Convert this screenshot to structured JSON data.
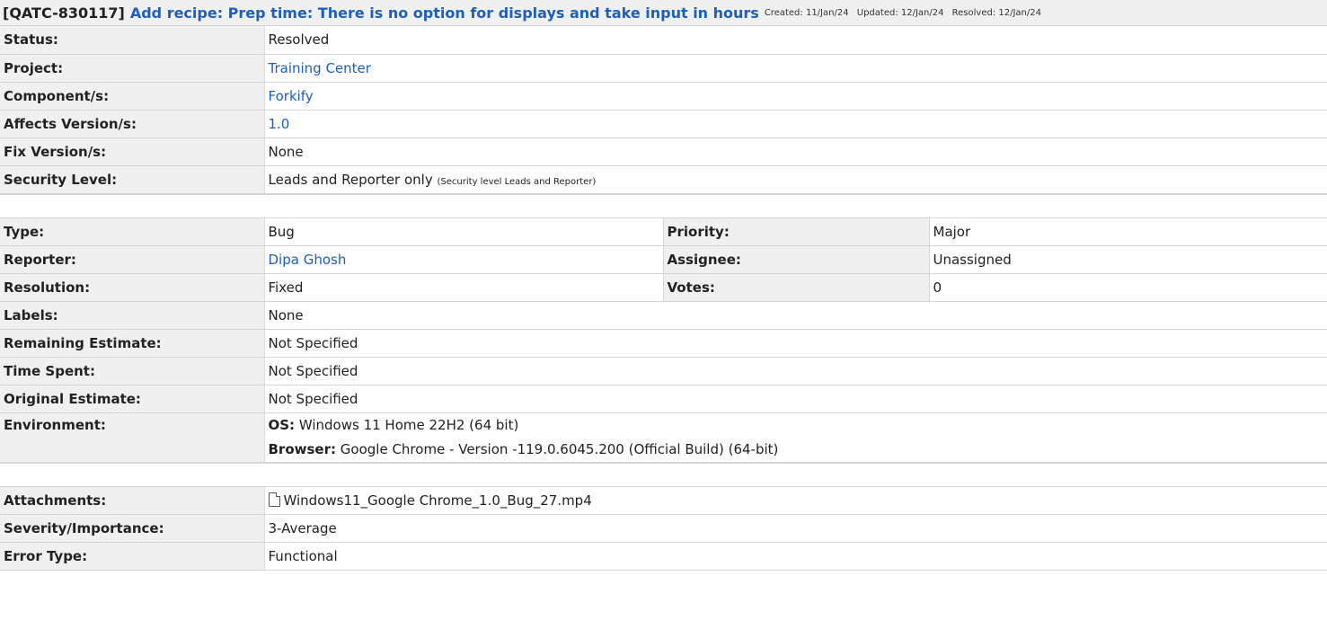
{
  "header": {
    "issue_key": "[QATC-830117]",
    "summary": "Add recipe: Prep time: There is no option for displays and take input in hours",
    "created": "Created: 11/Jan/24",
    "updated": "Updated: 12/Jan/24",
    "resolved": "Resolved: 12/Jan/24"
  },
  "details": {
    "status": {
      "label": "Status:",
      "value": "Resolved"
    },
    "project": {
      "label": "Project:",
      "value": "Training Center"
    },
    "component": {
      "label": "Component/s:",
      "value": "Forkify"
    },
    "affects_version": {
      "label": "Affects Version/s:",
      "value": "1.0"
    },
    "fix_version": {
      "label": "Fix Version/s:",
      "value": "None"
    },
    "security_level": {
      "label": "Security Level:",
      "value": "Leads and Reporter only",
      "note": "(Security level Leads and Reporter)"
    }
  },
  "people": {
    "type": {
      "label": "Type:",
      "value": "Bug"
    },
    "priority": {
      "label": "Priority:",
      "value": "Major"
    },
    "reporter": {
      "label": "Reporter:",
      "value": "Dipa Ghosh"
    },
    "assignee": {
      "label": "Assignee:",
      "value": "Unassigned"
    },
    "resolution": {
      "label": "Resolution:",
      "value": "Fixed"
    },
    "votes": {
      "label": "Votes:",
      "value": "0"
    },
    "labels": {
      "label": "Labels:",
      "value": "None"
    },
    "remaining_estimate": {
      "label": "Remaining Estimate:",
      "value": "Not Specified"
    },
    "time_spent": {
      "label": "Time Spent:",
      "value": "Not Specified"
    },
    "original_estimate": {
      "label": "Original Estimate:",
      "value": "Not Specified"
    },
    "environment": {
      "label": "Environment:",
      "os_label": "OS:",
      "os_value": "Windows 11 Home 22H2 (64 bit)",
      "browser_label": "Browser:",
      "browser_value": "Google Chrome - Version -119.0.6045.200 (Official Build) (64-bit)"
    }
  },
  "custom": {
    "attachments": {
      "label": "Attachments:",
      "value": "Windows11_Google Chrome_1.0_Bug_27.mp4",
      "icon": "file-icon"
    },
    "severity": {
      "label": "Severity/Importance:",
      "value": "3-Average"
    },
    "error_type": {
      "label": "Error Type:",
      "value": "Functional"
    }
  },
  "colors": {
    "link": "#1d5fbf",
    "label_bg": "#f0f0f0",
    "border": "#d6d6d6"
  }
}
